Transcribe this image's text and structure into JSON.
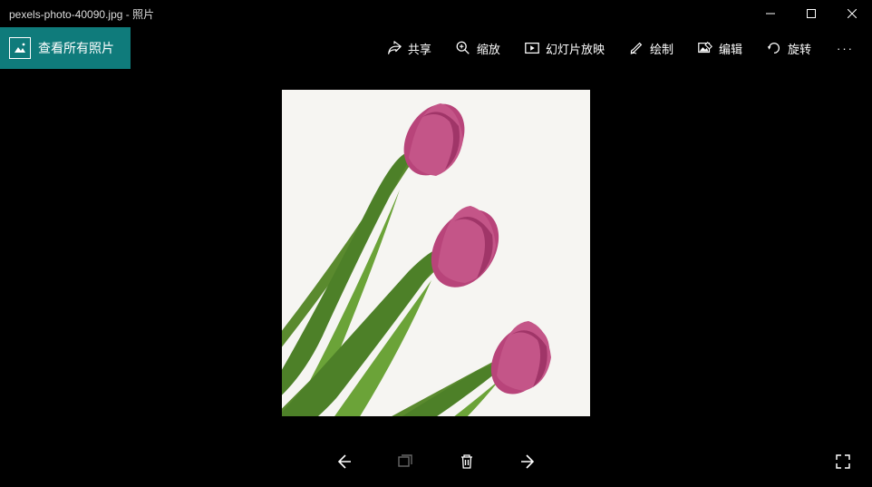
{
  "titlebar": {
    "title": "pexels-photo-40090.jpg - 照片"
  },
  "toolbar": {
    "view_all": "查看所有照片",
    "share": "共享",
    "zoom": "缩放",
    "slideshow": "幻灯片放映",
    "draw": "绘制",
    "edit": "编辑",
    "rotate": "旋转",
    "more": "···"
  }
}
